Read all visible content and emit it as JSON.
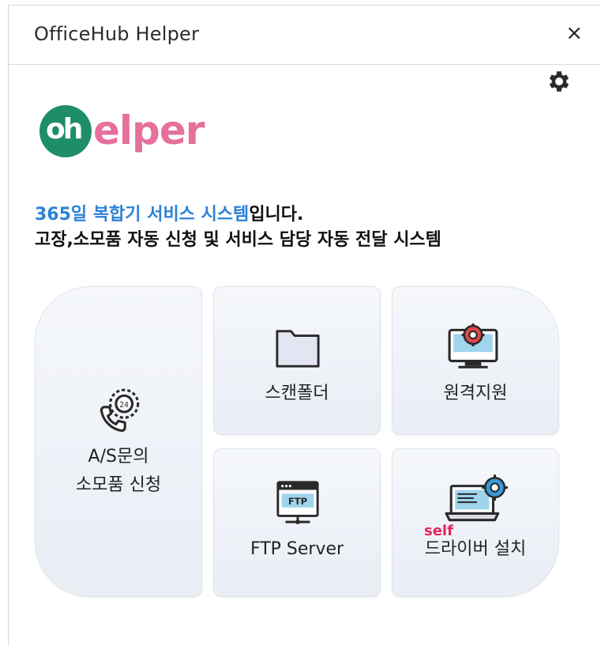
{
  "window": {
    "title": "OfficeHub Helper",
    "close_label": "×"
  },
  "icons": {
    "settings": "gear-icon",
    "close": "close-icon"
  },
  "logo": {
    "mark": "oh",
    "text": "elper",
    "mark_color": "#1f8c6a",
    "text_color": "#e66f9c"
  },
  "description": {
    "line1_accent": "365일 복합기 서비스 시스템",
    "line1_rest": "입니다.",
    "line2": "고장,소모품 자동 신청 및 서비스 담당 자동 전달 시스템",
    "accent_color": "#2d82d6"
  },
  "tiles": {
    "as": {
      "label_line1": "A/S문의",
      "label_line2": "소모품 신청",
      "icon": "support-call-icon"
    },
    "scan": {
      "label": "스캔폴더",
      "icon": "folder-icon"
    },
    "remote": {
      "label": "원격지원",
      "icon": "remote-monitor-icon"
    },
    "ftp": {
      "label": "FTP Server",
      "icon": "ftp-server-icon",
      "icon_text": "FTP"
    },
    "driver": {
      "self_label": "self",
      "label": "드라이버 설치",
      "icon": "laptop-gear-icon"
    }
  }
}
